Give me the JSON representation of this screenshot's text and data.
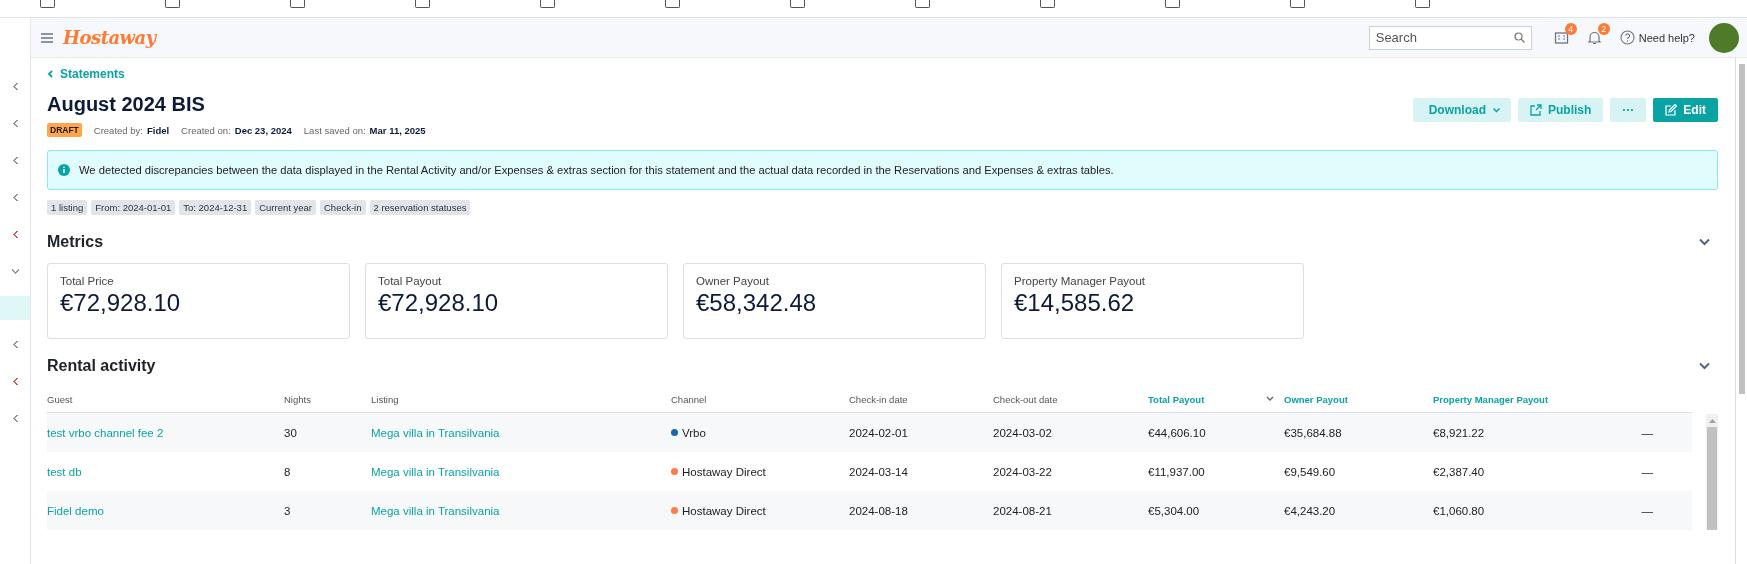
{
  "sidebar": {
    "items": [
      {
        "kind": "left",
        "color": "#8a94a6"
      },
      {
        "kind": "left",
        "color": "#8a94a6"
      },
      {
        "kind": "left",
        "color": "#8a94a6"
      },
      {
        "kind": "left",
        "color": "#8a94a6"
      },
      {
        "kind": "left",
        "color": "#c0605a"
      },
      {
        "kind": "down",
        "color": "#8a94a6"
      },
      {
        "kind": "active",
        "color": "#e0f7f7"
      },
      {
        "kind": "left",
        "color": "#8a94a6"
      },
      {
        "kind": "left",
        "color": "#c0605a"
      },
      {
        "kind": "left",
        "color": "#8a94a6"
      }
    ]
  },
  "topbar": {
    "logo": "Hostaway",
    "search": {
      "placeholder": "Search"
    },
    "listings_badge": "4",
    "notifications_badge": "2",
    "help": "Need help?"
  },
  "breadcrumb": "Statements",
  "title": "August 2024 BIS",
  "status": "DRAFT",
  "meta": [
    {
      "label": "Created by:",
      "value": "Fidel"
    },
    {
      "label": "Created on:",
      "value": "Dec 23, 2024"
    },
    {
      "label": "Last saved on:",
      "value": "Mar 11, 2025"
    }
  ],
  "actions": [
    {
      "kind": "download",
      "label": "Download"
    },
    {
      "kind": "publish",
      "label": "Publish"
    },
    {
      "kind": "more",
      "label": "···"
    },
    {
      "kind": "edit",
      "label": "Edit"
    }
  ],
  "alert": "We detected discrepancies between the data displayed in the Rental Activity and/or Expenses & extras section for this statement and the actual data recorded in the Reservations and Expenses & extras tables.",
  "filters": [
    "1 listing",
    "From: 2024-01-01",
    "To: 2024-12-31",
    "Current year",
    "Check-in",
    "2 reservation statuses"
  ],
  "metrics": {
    "title": "Metrics",
    "cards": [
      {
        "label": "Total Price",
        "value": "€72,928.10"
      },
      {
        "label": "Total Payout",
        "value": "€72,928.10"
      },
      {
        "label": "Owner Payout",
        "value": "€58,342.48"
      },
      {
        "label": "Property Manager Payout",
        "value": "€14,585.62"
      }
    ]
  },
  "rental_activity": {
    "title": "Rental activity",
    "columns": [
      {
        "label": "Guest",
        "highlighted": false,
        "sorted": false
      },
      {
        "label": "Nights",
        "highlighted": false,
        "sorted": false
      },
      {
        "label": "Listing",
        "highlighted": false,
        "sorted": false
      },
      {
        "label": "Channel",
        "highlighted": false,
        "sorted": false
      },
      {
        "label": "Check-in date",
        "highlighted": false,
        "sorted": false
      },
      {
        "label": "Check-out date",
        "highlighted": false,
        "sorted": false
      },
      {
        "label": "Total Payout",
        "highlighted": true,
        "sorted": true
      },
      {
        "label": "Owner Payout",
        "highlighted": true,
        "sorted": false
      },
      {
        "label": "Property Manager Payout",
        "highlighted": true,
        "sorted": false
      }
    ],
    "rows": [
      {
        "guest": "test vrbo channel fee 2",
        "nights": "30",
        "listing": "Mega villa in Transilvania",
        "channel": "Vrbo",
        "color": "#1a66b0",
        "check_in": "2024-02-01",
        "check_out": "2024-03-02",
        "total_payout": "€44,606.10",
        "owner_payout": "€35,684.88",
        "pm_payout": "€8,921.22",
        "column_10": "—"
      },
      {
        "guest": "test db",
        "nights": "8",
        "listing": "Mega villa in Transilvania",
        "channel": "Hostaway Direct",
        "color": "#ff7a4d",
        "check_in": "2024-03-14",
        "check_out": "2024-03-22",
        "total_payout": "€11,937.00",
        "owner_payout": "€9,549.60",
        "pm_payout": "€2,387.40",
        "column_10": "—"
      },
      {
        "guest": "Fidel demo",
        "nights": "3",
        "listing": "Mega villa in Transilvania",
        "channel": "Hostaway Direct",
        "color": "#ff7a4d",
        "check_in": "2024-08-18",
        "check_out": "2024-08-21",
        "total_payout": "€5,304.00",
        "owner_payout": "€4,243.20",
        "pm_payout": "€1,060.80",
        "column_10": "—"
      }
    ]
  }
}
